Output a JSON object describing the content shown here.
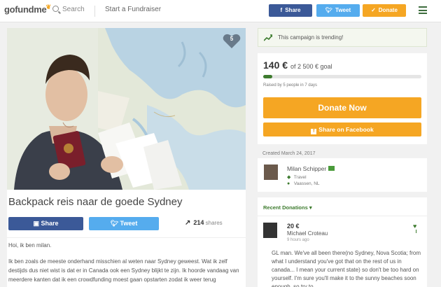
{
  "header": {
    "logo": "gofundme",
    "search_label": "Search",
    "start_label": "Start a Fundraiser",
    "share_label": "Share",
    "tweet_label": "Tweet",
    "donate_label": "Donate"
  },
  "hero": {
    "heart_count": "5"
  },
  "campaign": {
    "title": "Backpack reis naar de goede Sydney",
    "share_label": "Share",
    "tweet_label": "Tweet",
    "shares_count": "214",
    "shares_label": "shares",
    "greeting": "Hoi, ik ben milan.",
    "story": "Ik ben zoals de meeste onderhand misschien al weten naar Sydney geweest. Wat ik zelf destijds dus niet wist is dat er  in Canada ook een Sydney blijkt te zijn. Ik hoorde vandaag van meerdere kanten dat ik een crowdfunding moest gaan opstarten zodat ik weer terug"
  },
  "trending": {
    "text": "This campaign is trending!"
  },
  "goal": {
    "raised": "140 €",
    "goal_text": "of 2 500 € goal",
    "progress_fraction": 0.056,
    "raised_by": "Raised by 5 people in 7 days",
    "donate_now_label": "Donate Now",
    "share_facebook_label": "Share on Facebook"
  },
  "organizer": {
    "created": "Created March 24, 2017",
    "name": "Milan Schipper",
    "category": "Travel",
    "location": "Vaassen, NL"
  },
  "recent": {
    "title": "Recent Donations",
    "donation": {
      "amount": "20 €",
      "name": "Michael Croteau",
      "time": "9 hours ago",
      "comment": "GL man. We've all been there(no Sydney, Nova Scotia; from what I understand you've got that on the rest of us in canada... I mean your current state) so don't be too hard on yourself. I'm sure you'll make it to the sunny beaches soon enough, so try to"
    }
  },
  "colors": {
    "brand_green": "#3d7b2e",
    "facebook_blue": "#3b5998",
    "twitter_blue": "#55acee",
    "donate_orange": "#f5a623"
  }
}
